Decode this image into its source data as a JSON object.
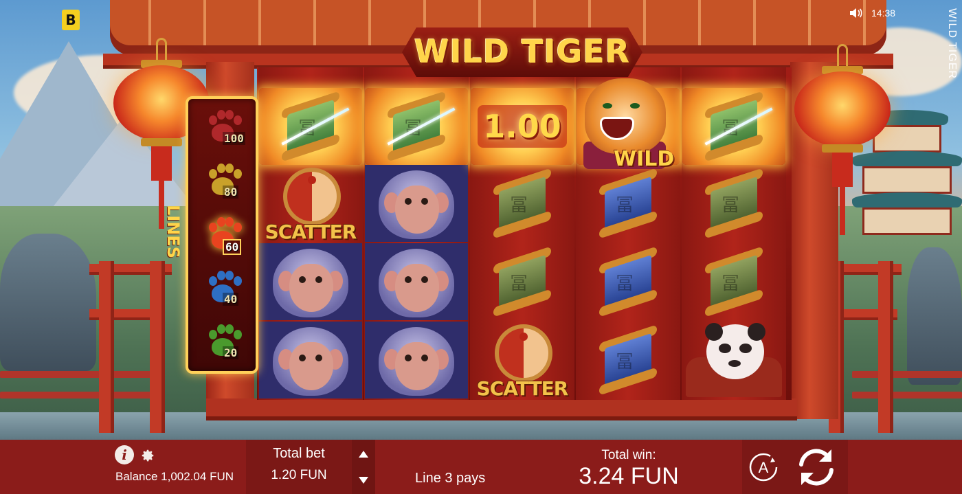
{
  "brand": {
    "logo_letter": "B"
  },
  "status": {
    "time": "14:38",
    "sound_icon": "speaker-icon"
  },
  "game": {
    "title": "WILD TIGER",
    "side_title": "WILD TIGER"
  },
  "lines_panel": {
    "label": "LINES",
    "options": [
      {
        "value": "100",
        "paw_color": "#b0282b",
        "active": false
      },
      {
        "value": "80",
        "paw_color": "#c9a12a",
        "active": false
      },
      {
        "value": "60",
        "paw_color": "#e8431f",
        "active": true
      },
      {
        "value": "40",
        "paw_color": "#2e6fc4",
        "active": false
      },
      {
        "value": "20",
        "paw_color": "#4a9a2d",
        "active": false
      }
    ]
  },
  "reels": {
    "columns": [
      [
        "green-scroll-win",
        "scatter",
        "monkey",
        "monkey"
      ],
      [
        "green-scroll-win",
        "monkey",
        "monkey",
        "monkey"
      ],
      [
        "multiplier-win",
        "olive-scroll",
        "olive-scroll",
        "scatter"
      ],
      [
        "wild-tiger-win",
        "blue-scroll",
        "blue-scroll",
        "blue-scroll"
      ],
      [
        "green-scroll-win",
        "olive-scroll",
        "olive-scroll",
        "panda"
      ]
    ],
    "multiplier_label": "1.00",
    "wild_label": "WILD",
    "scatter_label": "SCATTER"
  },
  "bottom_bar": {
    "balance_label": "Balance",
    "balance_value": "1,002.04 FUN",
    "total_bet_label": "Total bet",
    "total_bet_value": "1.20 FUN",
    "line_pays": "Line 3 pays",
    "total_win_label": "Total win:",
    "total_win_value": "3.24 FUN",
    "auto_label": "A"
  },
  "colors": {
    "bar_bg": "#8b1c1a",
    "gold": "#ffd54a",
    "frame_red": "#b9341f"
  }
}
